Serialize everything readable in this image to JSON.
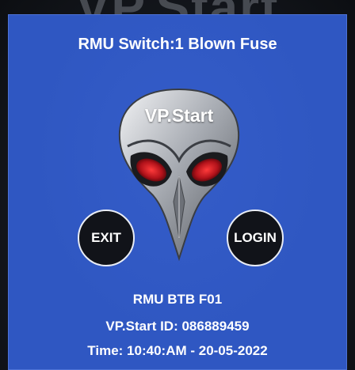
{
  "background": {
    "watermark_text": "VP.Start"
  },
  "dialog": {
    "title": "RMU Switch:1 Blown Fuse",
    "logo_text": "VP.Start",
    "exit_label": "EXIT",
    "login_label": "LOGIN",
    "device_name": "RMU BTB F01",
    "device_id": "VP.Start ID: 086889459",
    "timestamp": "Time: 10:40:AM - 20-05-2022"
  },
  "colors": {
    "panel": "#2f57c2",
    "button_fill": "#111319",
    "button_border": "#e9edf5",
    "eye_red": "#c4161c",
    "text": "#ffffff"
  },
  "icons": {
    "logo": "alien-mask-icon"
  }
}
